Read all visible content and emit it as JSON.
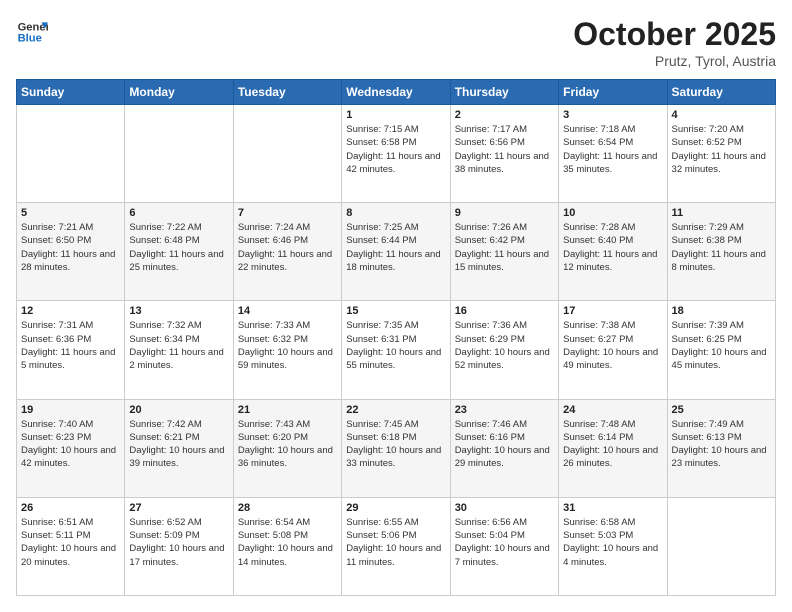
{
  "header": {
    "logo_line1": "General",
    "logo_line2": "Blue",
    "month": "October 2025",
    "location": "Prutz, Tyrol, Austria"
  },
  "weekdays": [
    "Sunday",
    "Monday",
    "Tuesday",
    "Wednesday",
    "Thursday",
    "Friday",
    "Saturday"
  ],
  "weeks": [
    [
      {
        "day": "",
        "info": ""
      },
      {
        "day": "",
        "info": ""
      },
      {
        "day": "",
        "info": ""
      },
      {
        "day": "1",
        "info": "Sunrise: 7:15 AM\nSunset: 6:58 PM\nDaylight: 11 hours and 42 minutes."
      },
      {
        "day": "2",
        "info": "Sunrise: 7:17 AM\nSunset: 6:56 PM\nDaylight: 11 hours and 38 minutes."
      },
      {
        "day": "3",
        "info": "Sunrise: 7:18 AM\nSunset: 6:54 PM\nDaylight: 11 hours and 35 minutes."
      },
      {
        "day": "4",
        "info": "Sunrise: 7:20 AM\nSunset: 6:52 PM\nDaylight: 11 hours and 32 minutes."
      }
    ],
    [
      {
        "day": "5",
        "info": "Sunrise: 7:21 AM\nSunset: 6:50 PM\nDaylight: 11 hours and 28 minutes."
      },
      {
        "day": "6",
        "info": "Sunrise: 7:22 AM\nSunset: 6:48 PM\nDaylight: 11 hours and 25 minutes."
      },
      {
        "day": "7",
        "info": "Sunrise: 7:24 AM\nSunset: 6:46 PM\nDaylight: 11 hours and 22 minutes."
      },
      {
        "day": "8",
        "info": "Sunrise: 7:25 AM\nSunset: 6:44 PM\nDaylight: 11 hours and 18 minutes."
      },
      {
        "day": "9",
        "info": "Sunrise: 7:26 AM\nSunset: 6:42 PM\nDaylight: 11 hours and 15 minutes."
      },
      {
        "day": "10",
        "info": "Sunrise: 7:28 AM\nSunset: 6:40 PM\nDaylight: 11 hours and 12 minutes."
      },
      {
        "day": "11",
        "info": "Sunrise: 7:29 AM\nSunset: 6:38 PM\nDaylight: 11 hours and 8 minutes."
      }
    ],
    [
      {
        "day": "12",
        "info": "Sunrise: 7:31 AM\nSunset: 6:36 PM\nDaylight: 11 hours and 5 minutes."
      },
      {
        "day": "13",
        "info": "Sunrise: 7:32 AM\nSunset: 6:34 PM\nDaylight: 11 hours and 2 minutes."
      },
      {
        "day": "14",
        "info": "Sunrise: 7:33 AM\nSunset: 6:32 PM\nDaylight: 10 hours and 59 minutes."
      },
      {
        "day": "15",
        "info": "Sunrise: 7:35 AM\nSunset: 6:31 PM\nDaylight: 10 hours and 55 minutes."
      },
      {
        "day": "16",
        "info": "Sunrise: 7:36 AM\nSunset: 6:29 PM\nDaylight: 10 hours and 52 minutes."
      },
      {
        "day": "17",
        "info": "Sunrise: 7:38 AM\nSunset: 6:27 PM\nDaylight: 10 hours and 49 minutes."
      },
      {
        "day": "18",
        "info": "Sunrise: 7:39 AM\nSunset: 6:25 PM\nDaylight: 10 hours and 45 minutes."
      }
    ],
    [
      {
        "day": "19",
        "info": "Sunrise: 7:40 AM\nSunset: 6:23 PM\nDaylight: 10 hours and 42 minutes."
      },
      {
        "day": "20",
        "info": "Sunrise: 7:42 AM\nSunset: 6:21 PM\nDaylight: 10 hours and 39 minutes."
      },
      {
        "day": "21",
        "info": "Sunrise: 7:43 AM\nSunset: 6:20 PM\nDaylight: 10 hours and 36 minutes."
      },
      {
        "day": "22",
        "info": "Sunrise: 7:45 AM\nSunset: 6:18 PM\nDaylight: 10 hours and 33 minutes."
      },
      {
        "day": "23",
        "info": "Sunrise: 7:46 AM\nSunset: 6:16 PM\nDaylight: 10 hours and 29 minutes."
      },
      {
        "day": "24",
        "info": "Sunrise: 7:48 AM\nSunset: 6:14 PM\nDaylight: 10 hours and 26 minutes."
      },
      {
        "day": "25",
        "info": "Sunrise: 7:49 AM\nSunset: 6:13 PM\nDaylight: 10 hours and 23 minutes."
      }
    ],
    [
      {
        "day": "26",
        "info": "Sunrise: 6:51 AM\nSunset: 5:11 PM\nDaylight: 10 hours and 20 minutes."
      },
      {
        "day": "27",
        "info": "Sunrise: 6:52 AM\nSunset: 5:09 PM\nDaylight: 10 hours and 17 minutes."
      },
      {
        "day": "28",
        "info": "Sunrise: 6:54 AM\nSunset: 5:08 PM\nDaylight: 10 hours and 14 minutes."
      },
      {
        "day": "29",
        "info": "Sunrise: 6:55 AM\nSunset: 5:06 PM\nDaylight: 10 hours and 11 minutes."
      },
      {
        "day": "30",
        "info": "Sunrise: 6:56 AM\nSunset: 5:04 PM\nDaylight: 10 hours and 7 minutes."
      },
      {
        "day": "31",
        "info": "Sunrise: 6:58 AM\nSunset: 5:03 PM\nDaylight: 10 hours and 4 minutes."
      },
      {
        "day": "",
        "info": ""
      }
    ]
  ]
}
